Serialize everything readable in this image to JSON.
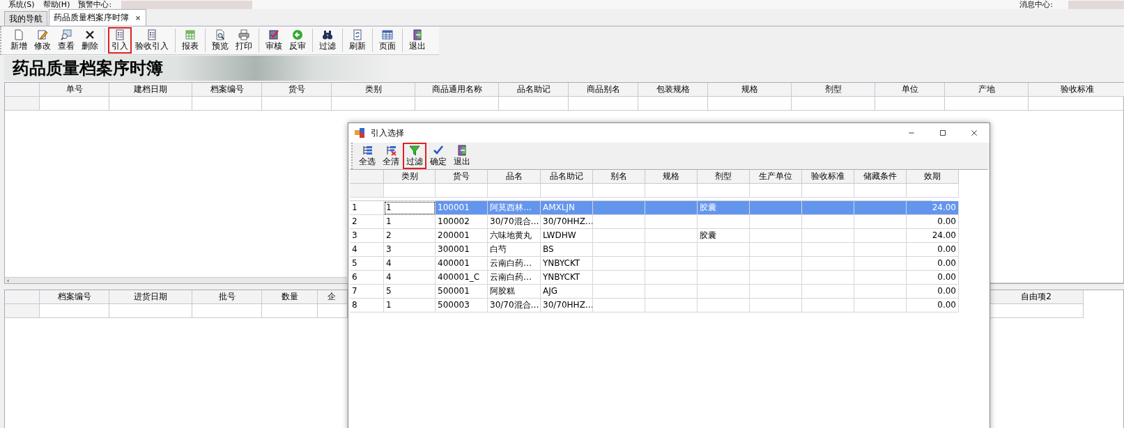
{
  "menu_bar": {
    "items": [
      "系统(S)",
      "帮助(H)",
      "预警中心:"
    ],
    "message_center": "消息中心:"
  },
  "tabs": [
    {
      "label": "我的导航",
      "selected": false,
      "closable": false
    },
    {
      "label": "药品质量档案序时簿",
      "selected": true,
      "closable": true
    }
  ],
  "toolbar": {
    "groups": [
      [
        {
          "label": "新增",
          "highlighted": false
        },
        {
          "label": "修改",
          "highlighted": false
        },
        {
          "label": "查看",
          "highlighted": false
        },
        {
          "label": "删除",
          "highlighted": false
        }
      ],
      [
        {
          "label": "引入",
          "highlighted": true
        },
        {
          "label": "验收引入",
          "highlighted": false
        }
      ],
      [
        {
          "label": "报表",
          "highlighted": false
        }
      ],
      [
        {
          "label": "预览",
          "highlighted": false
        },
        {
          "label": "打印",
          "highlighted": false
        }
      ],
      [
        {
          "label": "审核",
          "highlighted": false
        },
        {
          "label": "反审",
          "highlighted": false
        }
      ],
      [
        {
          "label": "过滤",
          "highlighted": false
        }
      ],
      [
        {
          "label": "刷新",
          "highlighted": false
        }
      ],
      [
        {
          "label": "页面",
          "highlighted": false
        }
      ],
      [
        {
          "label": "退出",
          "highlighted": false
        }
      ]
    ]
  },
  "banner": {
    "title": "药品质量档案序时簿"
  },
  "main_grid": {
    "columns": [
      "单号",
      "建档日期",
      "档案编号",
      "货号",
      "类别",
      "商品通用名称",
      "品名助记",
      "商品别名",
      "包装规格",
      "规格",
      "剂型",
      "单位",
      "产地",
      "验收标准"
    ]
  },
  "detail_grid": {
    "columns": [
      "档案编号",
      "进货日期",
      "批号",
      "数量",
      "企",
      "自由项2"
    ]
  },
  "dialog": {
    "title": "引入选择",
    "toolbar": [
      {
        "label": "全选",
        "highlighted": false
      },
      {
        "label": "全清",
        "highlighted": false
      },
      {
        "label": "过滤",
        "highlighted": true
      },
      {
        "label": "确定",
        "highlighted": false
      },
      {
        "label": "退出",
        "highlighted": false
      }
    ],
    "columns": [
      "类别",
      "货号",
      "品名",
      "品名助记",
      "别名",
      "规格",
      "剂型",
      "生产单位",
      "验收标准",
      "储藏条件",
      "效期"
    ],
    "rows": [
      {
        "number": "1",
        "category": "1",
        "code": "100001",
        "name": "阿莫西林…",
        "mnemonic": "AMXLJN",
        "dosage_form": "胶囊",
        "expiry": "24.00",
        "selected": true
      },
      {
        "number": "2",
        "category": "1",
        "code": "100002",
        "name": "30/70混合…",
        "mnemonic": "30/70HHZ…",
        "expiry": "0.00",
        "selected": false
      },
      {
        "number": "3",
        "category": "2",
        "code": "200001",
        "name": "六味地黄丸",
        "mnemonic": "LWDHW",
        "dosage_form": "胶囊",
        "expiry": "24.00",
        "selected": false
      },
      {
        "number": "4",
        "category": "3",
        "code": "300001",
        "name": "白芍",
        "mnemonic": "BS",
        "expiry": "0.00",
        "selected": false
      },
      {
        "number": "5",
        "category": "4",
        "code": "400001",
        "name": "云南白药…",
        "mnemonic": "YNBYCKT",
        "expiry": "0.00",
        "selected": false
      },
      {
        "number": "6",
        "category": "4",
        "code": "400001_C",
        "name": "云南白药…",
        "mnemonic": "YNBYCKT",
        "expiry": "0.00",
        "selected": false
      },
      {
        "number": "7",
        "category": "5",
        "code": "500001",
        "name": "阿胶糕",
        "mnemonic": "AJG",
        "expiry": "0.00",
        "selected": false
      },
      {
        "number": "8",
        "category": "1",
        "code": "500003",
        "name": "30/70混合…",
        "mnemonic": "30/70HHZ…",
        "expiry": "0.00",
        "selected": false
      }
    ]
  }
}
